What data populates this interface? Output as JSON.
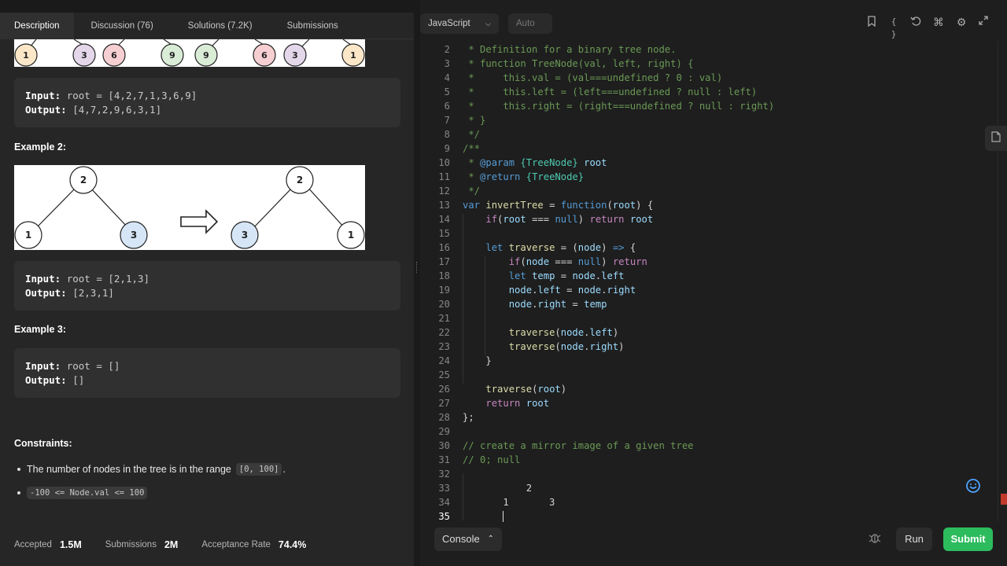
{
  "tabs": [
    {
      "label": "Description"
    },
    {
      "label": "Discussion (76)"
    },
    {
      "label": "Solutions (7.2K)"
    },
    {
      "label": "Submissions"
    }
  ],
  "example1": {
    "nodes": [
      "1",
      "3",
      "6",
      "9",
      "9",
      "6",
      "3",
      "1"
    ],
    "input_label": "Input:",
    "input_value": "root = [4,2,7,1,3,6,9]",
    "output_label": "Output:",
    "output_value": "[4,7,2,9,6,3,1]"
  },
  "example2": {
    "heading": "Example 2:",
    "tree_before": {
      "root": "2",
      "left": "1",
      "right": "3"
    },
    "tree_after": {
      "root": "2",
      "left": "3",
      "right": "1"
    },
    "input_label": "Input:",
    "input_value": "root = [2,1,3]",
    "output_label": "Output:",
    "output_value": "[2,3,1]"
  },
  "example3": {
    "heading": "Example 3:",
    "input_label": "Input:",
    "input_value": "root = []",
    "output_label": "Output:",
    "output_value": "[]"
  },
  "constraints": {
    "heading": "Constraints:",
    "item1_text": "The number of nodes in the tree is in the range",
    "item1_code": "[0, 100]",
    "item1_suffix": ".",
    "item2_code": "-100 <= Node.val <= 100"
  },
  "stats": {
    "accepted_label": "Accepted",
    "accepted_value": "1.5M",
    "submissions_label": "Submissions",
    "submissions_value": "2M",
    "rate_label": "Acceptance Rate",
    "rate_value": "74.4%"
  },
  "toolbar": {
    "language": "JavaScript",
    "mode": "Auto"
  },
  "colors": {
    "node_purple": "#e4d7ea",
    "node_red": "#f6cfd2",
    "node_green": "#d9ecd6",
    "node_yellow": "#fbe7c8",
    "node_blue": "#d6e6f7",
    "submit_green": "#2cbb5d"
  },
  "bottombar": {
    "console_label": "Console",
    "run_label": "Run",
    "submit_label": "Submit"
  }
}
